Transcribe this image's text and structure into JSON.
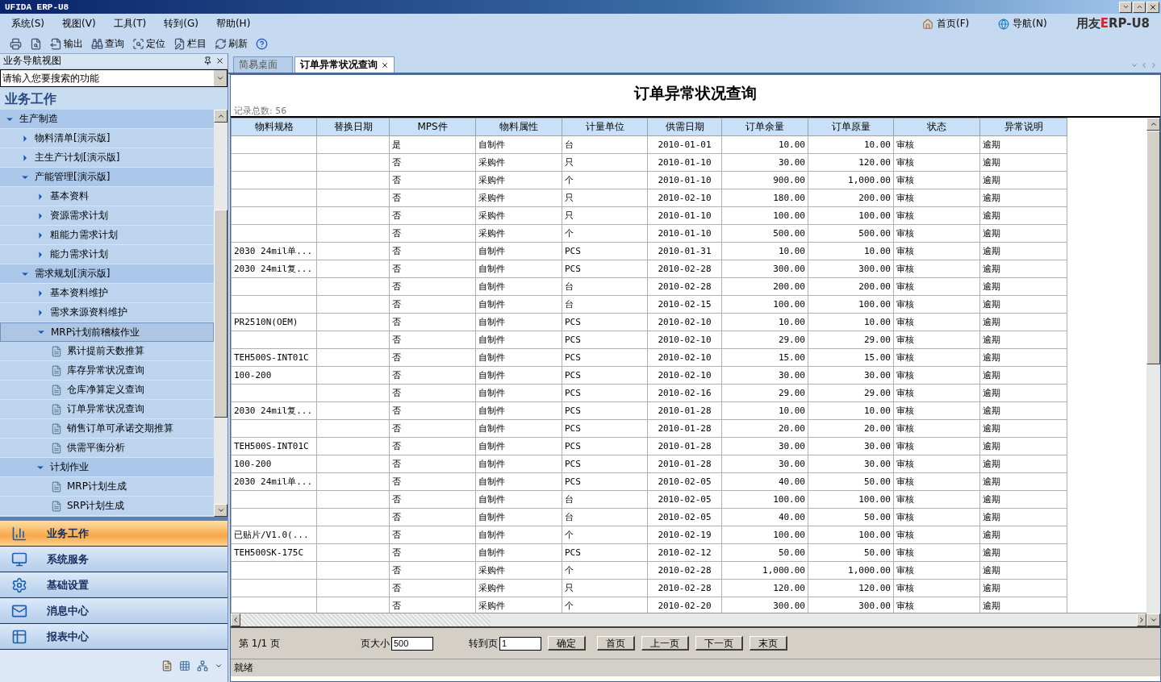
{
  "window": {
    "title": "UFIDA ERP-U8"
  },
  "menu": [
    "系统(S)",
    "视图(V)",
    "工具(T)",
    "转到(G)",
    "帮助(H)"
  ],
  "toolbar": [
    {
      "kind": "icon"
    },
    {
      "kind": "icon"
    },
    {
      "kind": "text",
      "label": "输出"
    },
    {
      "kind": "text",
      "label": "查询"
    },
    {
      "kind": "text",
      "label": "定位"
    },
    {
      "kind": "text",
      "label": "栏目"
    },
    {
      "kind": "text",
      "label": "刷新"
    },
    {
      "kind": "icon"
    }
  ],
  "top_links": [
    "首页(F)",
    "导航(N)"
  ],
  "brand": {
    "prefix": "用友",
    "accent": "E",
    "rest": "RP-U8"
  },
  "nav_panel": {
    "title": "业务导航视图",
    "search": {
      "placeholder": "请输入您要搜索的功能"
    },
    "section": "业务工作",
    "tree": [
      {
        "label": "生产制造",
        "kind": "folder",
        "expanded": true,
        "selected": false,
        "children": [
          {
            "label": "物料清单[演示版]",
            "kind": "folder",
            "expanded": false,
            "selected": false
          },
          {
            "label": "主生产计划[演示版]",
            "kind": "folder",
            "expanded": false,
            "selected": false
          },
          {
            "label": "产能管理[演示版]",
            "kind": "folder",
            "expanded": true,
            "selected": false,
            "children": [
              {
                "label": "基本资料",
                "kind": "folder",
                "expanded": false,
                "selected": false
              },
              {
                "label": "资源需求计划",
                "kind": "folder",
                "expanded": false,
                "selected": false
              },
              {
                "label": "粗能力需求计划",
                "kind": "folder",
                "expanded": false,
                "selected": false
              },
              {
                "label": "能力需求计划",
                "kind": "folder",
                "expanded": false,
                "selected": false
              }
            ]
          },
          {
            "label": "需求规划[演示版]",
            "kind": "folder",
            "expanded": true,
            "selected": false,
            "children": [
              {
                "label": "基本资料维护",
                "kind": "folder",
                "expanded": false,
                "selected": false
              },
              {
                "label": "需求来源资料维护",
                "kind": "folder",
                "expanded": false,
                "selected": false
              },
              {
                "label": "MRP计划前稽核作业",
                "kind": "folder",
                "expanded": true,
                "selected": true,
                "children": [
                  {
                    "label": "累计提前天数推算",
                    "kind": "leaf",
                    "selected": false
                  },
                  {
                    "label": "库存异常状况查询",
                    "kind": "leaf",
                    "selected": false
                  },
                  {
                    "label": "仓库净算定义查询",
                    "kind": "leaf",
                    "selected": false
                  },
                  {
                    "label": "订单异常状况查询",
                    "kind": "leaf",
                    "selected": false
                  },
                  {
                    "label": "销售订单可承诺交期推算",
                    "kind": "leaf",
                    "selected": false
                  },
                  {
                    "label": "供需平衡分析",
                    "kind": "leaf",
                    "selected": false
                  }
                ]
              },
              {
                "label": "计划作业",
                "kind": "folder",
                "expanded": true,
                "selected": false,
                "children": [
                  {
                    "label": "MRP计划生成",
                    "kind": "leaf",
                    "selected": false
                  },
                  {
                    "label": "SRP计划生成",
                    "kind": "leaf",
                    "selected": false
                  }
                ]
              }
            ]
          }
        ]
      }
    ],
    "modules": [
      {
        "label": "业务工作",
        "selected": true
      },
      {
        "label": "系统服务",
        "selected": false
      },
      {
        "label": "基础设置",
        "selected": false
      },
      {
        "label": "消息中心",
        "selected": false
      },
      {
        "label": "报表中心",
        "selected": false
      }
    ]
  },
  "tabs": [
    {
      "label": "简易桌面",
      "selected": false
    },
    {
      "label": "订单异常状况查询",
      "selected": true
    }
  ],
  "report": {
    "title": "订单异常状况查询",
    "record_count": "记录总数: 56",
    "columns": [
      "物料规格",
      "替换日期",
      "MPS件",
      "物料属性",
      "计量单位",
      "供需日期",
      "订单余量",
      "订单原量",
      "状态",
      "异常说明"
    ],
    "rows": [
      [
        null,
        null,
        "是",
        "自制件",
        "台",
        "2010-01-01",
        "10.00",
        "10.00",
        "审核",
        "逾期"
      ],
      [
        null,
        null,
        "否",
        "采购件",
        "只",
        "2010-01-10",
        "30.00",
        "120.00",
        "审核",
        "逾期"
      ],
      [
        null,
        null,
        "否",
        "采购件",
        "个",
        "2010-01-10",
        "900.00",
        "1,000.00",
        "审核",
        "逾期"
      ],
      [
        null,
        null,
        "否",
        "采购件",
        "只",
        "2010-02-10",
        "180.00",
        "200.00",
        "审核",
        "逾期"
      ],
      [
        null,
        null,
        "否",
        "采购件",
        "只",
        "2010-01-10",
        "100.00",
        "100.00",
        "审核",
        "逾期"
      ],
      [
        null,
        null,
        "否",
        "采购件",
        "个",
        "2010-01-10",
        "500.00",
        "500.00",
        "审核",
        "逾期"
      ],
      [
        "2030 24mil单...",
        null,
        "否",
        "自制件",
        "PCS",
        "2010-01-31",
        "10.00",
        "10.00",
        "审核",
        "逾期"
      ],
      [
        "2030 24mil复...",
        null,
        "否",
        "自制件",
        "PCS",
        "2010-02-28",
        "300.00",
        "300.00",
        "审核",
        "逾期"
      ],
      [
        null,
        null,
        "否",
        "自制件",
        "台",
        "2010-02-28",
        "200.00",
        "200.00",
        "审核",
        "逾期"
      ],
      [
        null,
        null,
        "否",
        "自制件",
        "台",
        "2010-02-15",
        "100.00",
        "100.00",
        "审核",
        "逾期"
      ],
      [
        "PR2510N(OEM)",
        null,
        "否",
        "自制件",
        "PCS",
        "2010-02-10",
        "10.00",
        "10.00",
        "审核",
        "逾期"
      ],
      [
        null,
        null,
        "否",
        "自制件",
        "PCS",
        "2010-02-10",
        "29.00",
        "29.00",
        "审核",
        "逾期"
      ],
      [
        "TEH500S-INT01C",
        null,
        "否",
        "自制件",
        "PCS",
        "2010-02-10",
        "15.00",
        "15.00",
        "审核",
        "逾期"
      ],
      [
        "100-200",
        null,
        "否",
        "自制件",
        "PCS",
        "2010-02-10",
        "30.00",
        "30.00",
        "审核",
        "逾期"
      ],
      [
        null,
        null,
        "否",
        "自制件",
        "PCS",
        "2010-02-16",
        "29.00",
        "29.00",
        "审核",
        "逾期"
      ],
      [
        "2030 24mil复...",
        null,
        "否",
        "自制件",
        "PCS",
        "2010-01-28",
        "10.00",
        "10.00",
        "审核",
        "逾期"
      ],
      [
        null,
        null,
        "否",
        "自制件",
        "PCS",
        "2010-01-28",
        "20.00",
        "20.00",
        "审核",
        "逾期"
      ],
      [
        "TEH500S-INT01C",
        null,
        "否",
        "自制件",
        "PCS",
        "2010-01-28",
        "30.00",
        "30.00",
        "审核",
        "逾期"
      ],
      [
        "100-200",
        null,
        "否",
        "自制件",
        "PCS",
        "2010-01-28",
        "30.00",
        "30.00",
        "审核",
        "逾期"
      ],
      [
        "2030 24mil单...",
        null,
        "否",
        "自制件",
        "PCS",
        "2010-02-05",
        "40.00",
        "50.00",
        "审核",
        "逾期"
      ],
      [
        null,
        null,
        "否",
        "自制件",
        "台",
        "2010-02-05",
        "100.00",
        "100.00",
        "审核",
        "逾期"
      ],
      [
        null,
        null,
        "否",
        "自制件",
        "台",
        "2010-02-05",
        "40.00",
        "50.00",
        "审核",
        "逾期"
      ],
      [
        "已贴片/V1.0(...",
        null,
        "否",
        "自制件",
        "个",
        "2010-02-19",
        "100.00",
        "100.00",
        "审核",
        "逾期"
      ],
      [
        "TEH500SK-175C",
        null,
        "否",
        "自制件",
        "PCS",
        "2010-02-12",
        "50.00",
        "50.00",
        "审核",
        "逾期"
      ],
      [
        null,
        null,
        "否",
        "采购件",
        "个",
        "2010-02-28",
        "1,000.00",
        "1,000.00",
        "审核",
        "逾期"
      ],
      [
        null,
        null,
        "否",
        "采购件",
        "只",
        "2010-02-28",
        "120.00",
        "120.00",
        "审核",
        "逾期"
      ],
      [
        null,
        null,
        "否",
        "采购件",
        "个",
        "2010-02-20",
        "300.00",
        "300.00",
        "审核",
        "逾期"
      ]
    ]
  },
  "pager": {
    "page": "第 1/1 页",
    "size_label": "页大小",
    "size_value": "500",
    "goto_label": "转到页",
    "goto_value": "1",
    "buttons": [
      "确定",
      "首页",
      "上一页",
      "下一页",
      "末页"
    ]
  },
  "status_bar": "就绪"
}
